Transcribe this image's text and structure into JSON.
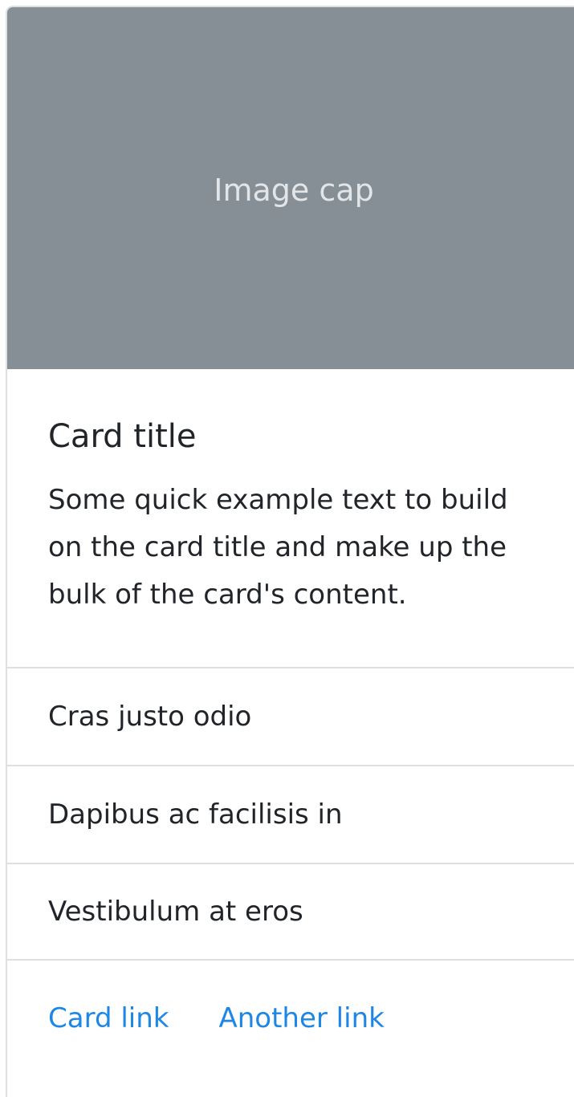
{
  "card": {
    "image_cap": "Image cap",
    "title": "Card title",
    "text": "Some quick example text to build on the card title and make up the bulk of the card's content.",
    "list_items": [
      {
        "label": "Cras justo odio"
      },
      {
        "label": "Dapibus ac facilisis in"
      },
      {
        "label": "Vestibulum at eros"
      }
    ],
    "links": [
      {
        "label": "Card link"
      },
      {
        "label": "Another link"
      }
    ]
  },
  "colors": {
    "image_cap_bg": "#868e96",
    "link": "#1e87e5",
    "border": "#dfdfdf"
  }
}
